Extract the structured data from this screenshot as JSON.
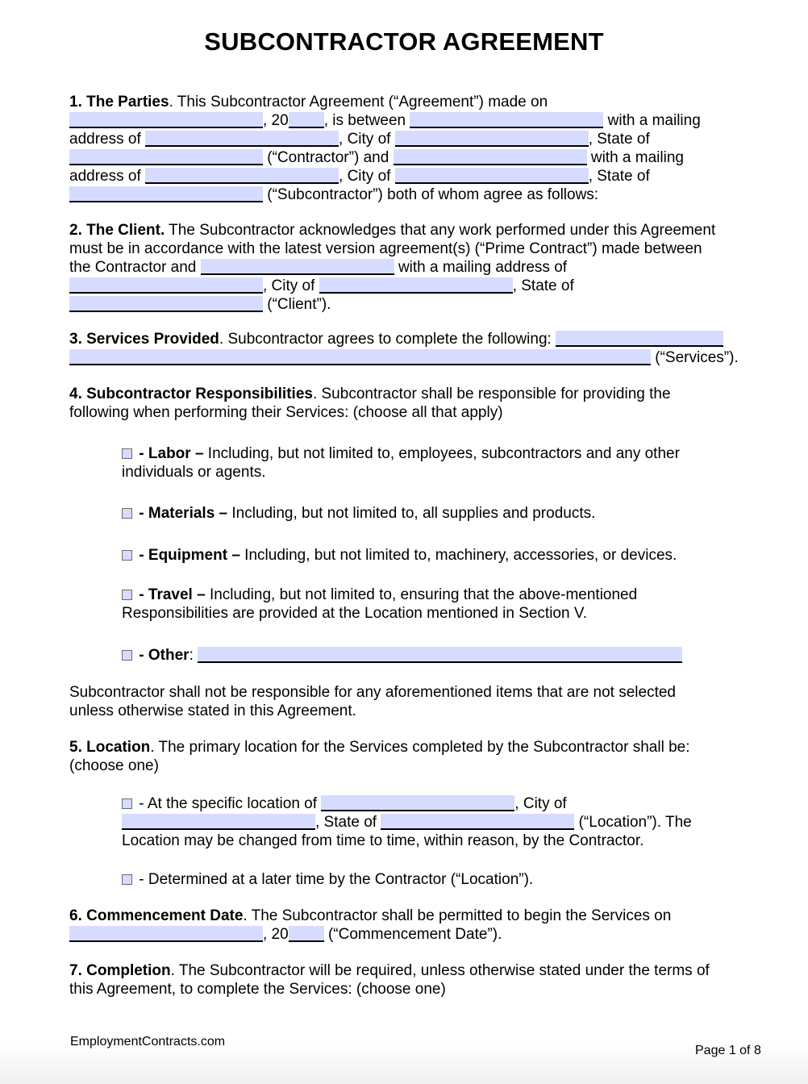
{
  "document": {
    "title": "SUBCONTRACTOR AGREEMENT"
  },
  "colors": {
    "field_fill": "#d6dcff",
    "text": "#000000"
  },
  "s1": {
    "heading": "1. The Parties",
    "l1": ". This Subcontractor Agreement (“Agreement”) made on",
    "t_20": ", 20",
    "t_between": ", is between",
    "t_mailing": "with a mailing",
    "t_address": "address of",
    "t_city": ", City of",
    "t_state": ", State of",
    "t_contractor": "(“Contractor”) and",
    "t_mailing2": "with a mailing",
    "t_address2": "address of",
    "t_city2": ", City of",
    "t_state2": ", State of",
    "t_sub": "(“Subcontractor”) both of whom agree as follows:"
  },
  "s2": {
    "heading": "2. The Client.",
    "l1": " The Subcontractor acknowledges that any work performed under this Agreement",
    "l2": "must be in accordance with the latest version agreement(s) (“Prime Contract”) made between",
    "t_contractor_and": "the Contractor and",
    "t_mailing_address": "with a mailing address of",
    "t_city": ", City of",
    "t_state": ", State of",
    "t_client": "(“Client”)."
  },
  "s3": {
    "heading": "3. Services Provided",
    "l1": ". Subcontractor agrees to complete the following:",
    "t_services": "(“Services”)."
  },
  "s4": {
    "heading": "4. Subcontractor Responsibilities",
    "l1": ". Subcontractor shall be responsible for providing the",
    "l2": "following when performing their Services: (choose all that apply)",
    "options": [
      {
        "label": "Labor –",
        "text": " Including, but not limited to, employees, subcontractors and any other",
        "text2": "individuals or agents.",
        "checked": false
      },
      {
        "label": "Materials –",
        "text": " Including, but not limited to, all supplies and products.",
        "checked": false
      },
      {
        "label": "Equipment –",
        "text": " Including, but not limited to, machinery, accessories, or devices.",
        "checked": false
      },
      {
        "label": "Travel –",
        "text": " Including, but not limited to, ensuring that the above-mentioned",
        "text2": "Responsibilities are provided at the Location mentioned in Section V.",
        "checked": false
      },
      {
        "label": "Other",
        "text": ":",
        "checked": false
      }
    ],
    "dash": " - ",
    "note1": "Subcontractor shall not be responsible for any aforementioned items that are not selected",
    "note2": "unless otherwise stated in this Agreement."
  },
  "s5": {
    "heading": "5. Location",
    "l1": ". The primary location for the Services completed by the Subcontractor shall be:",
    "l2": "(choose one)",
    "opt1_a": " - At the specific location of",
    "opt1_city": ", City of",
    "opt1_state": ", State of",
    "opt1_loc": "(“Location”). The",
    "opt1_l3": "Location may be changed from time to time, within reason, by the Contractor.",
    "opt2": " - Determined at a later time by the Contractor (“Location”)."
  },
  "s6": {
    "heading": "6. Commencement Date",
    "l1": ". The Subcontractor shall be permitted to begin the Services on",
    "t_20": ", 20",
    "t_cd": " (“Commencement Date”)."
  },
  "s7": {
    "heading": "7. Completion",
    "l1": ". The Subcontractor will be required, unless otherwise stated under the terms of",
    "l2": "this Agreement, to complete the Services: (choose one)"
  },
  "footer": {
    "site": "EmploymentContracts.com",
    "page": "Page 1 of 8"
  }
}
